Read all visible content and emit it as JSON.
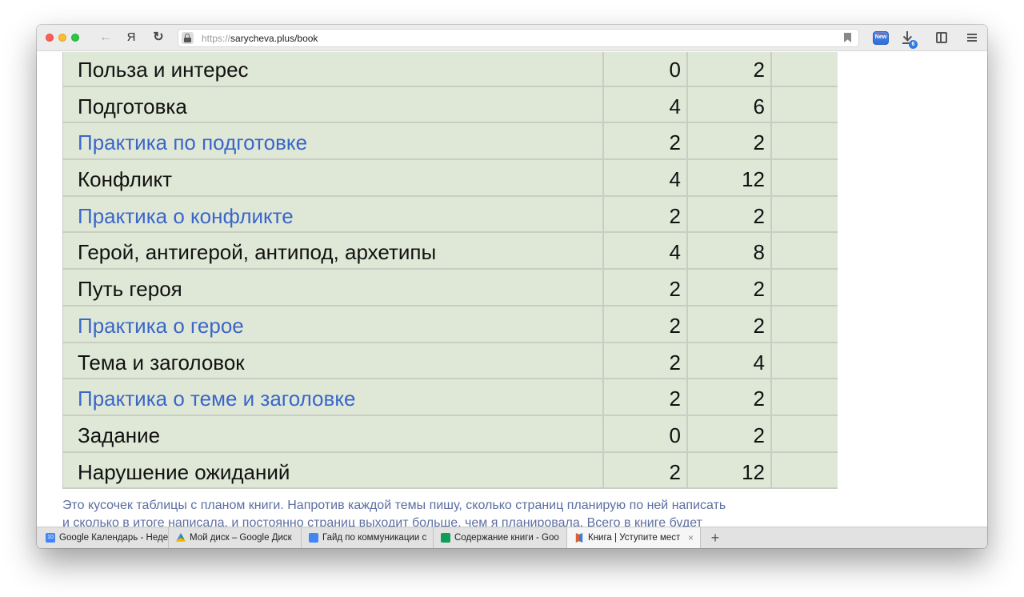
{
  "browser": {
    "url_protocol": "https://",
    "url_rest": "sarycheva.plus/book",
    "back_glyph": "←",
    "yandex_glyph": "Я",
    "reload_glyph": "↻",
    "extension_badge": "New",
    "download_badge": "6"
  },
  "table": {
    "rows": [
      {
        "topic": "Польза и интерес",
        "a": "0",
        "b": "2",
        "practice": false
      },
      {
        "topic": "Подготовка",
        "a": "4",
        "b": "6",
        "practice": false
      },
      {
        "topic": "Практика по подготовке",
        "a": "2",
        "b": "2",
        "practice": true
      },
      {
        "topic": "Конфликт",
        "a": "4",
        "b": "12",
        "practice": false
      },
      {
        "topic": "Практика о конфликте",
        "a": "2",
        "b": "2",
        "practice": true
      },
      {
        "topic": "Герой, антигерой, антипод, архетипы",
        "a": "4",
        "b": "8",
        "practice": false
      },
      {
        "topic": "Путь героя",
        "a": "2",
        "b": "2",
        "practice": false
      },
      {
        "topic": "Практика о герое",
        "a": "2",
        "b": "2",
        "practice": true
      },
      {
        "topic": "Тема и заголовок",
        "a": "2",
        "b": "4",
        "practice": false
      },
      {
        "topic": "Практика о теме и заголовке",
        "a": "2",
        "b": "2",
        "practice": true
      },
      {
        "topic": "Задание",
        "a": "0",
        "b": "2",
        "practice": false
      },
      {
        "topic": "Нарушение ожиданий",
        "a": "2",
        "b": "12",
        "practice": false
      }
    ]
  },
  "caption": {
    "line1": "Это кусочек таблицы с планом книги. Напротив каждой темы пишу, сколько страниц планирую по ней написать",
    "line2": "и сколько в итоге написала, и постоянно страниц выходит больше, чем я планировала. Всего в книге будет"
  },
  "tabs": [
    {
      "label": "Google Календарь - Неде",
      "icon": "calendar-icon",
      "fav_text": "10"
    },
    {
      "label": "Мой диск – Google Диск",
      "icon": "drive-icon",
      "fav_text": ""
    },
    {
      "label": "Гайд по коммуникации с",
      "icon": "docs-icon",
      "fav_text": ""
    },
    {
      "label": "Содержание книги - Goo",
      "icon": "sheets-icon",
      "fav_text": ""
    },
    {
      "label": "Книга | Уступите мест",
      "icon": "book-icon",
      "fav_text": "",
      "active": true
    }
  ],
  "new_tab_glyph": "+",
  "close_glyph": "×"
}
